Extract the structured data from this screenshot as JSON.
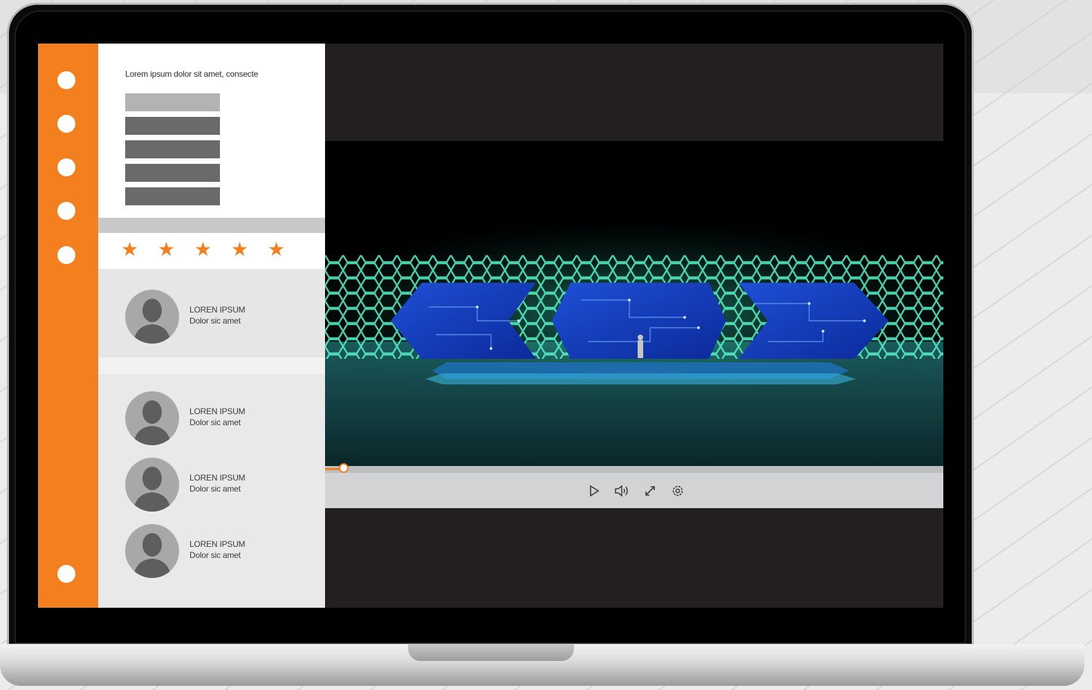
{
  "colors": {
    "accent": "#f37f1e",
    "rail": "#f37f1e",
    "screen_bg": "#231f20",
    "controls_bg": "#d1d3d4"
  },
  "sidebar": {
    "dots": [
      "nav-dot-1",
      "nav-dot-2",
      "nav-dot-3",
      "nav-dot-4",
      "nav-dot-5",
      "nav-dot-6"
    ]
  },
  "panel": {
    "heading": "Lorem ipsum dolor sit amet, consecte",
    "rating": {
      "stars": 5,
      "max": 5
    },
    "people": [
      {
        "name": "LOREN IPSUM",
        "subtitle": "Dolor sic amet"
      },
      {
        "name": "LOREN IPSUM",
        "subtitle": "Dolor sic amet"
      },
      {
        "name": "LOREN IPSUM",
        "subtitle": "Dolor sic amet"
      },
      {
        "name": "LOREN IPSUM",
        "subtitle": "Dolor sic amet"
      }
    ]
  },
  "player": {
    "progress": 0.03,
    "controls": [
      "play-icon",
      "volume-icon",
      "fullscreen-icon",
      "settings-icon"
    ]
  }
}
